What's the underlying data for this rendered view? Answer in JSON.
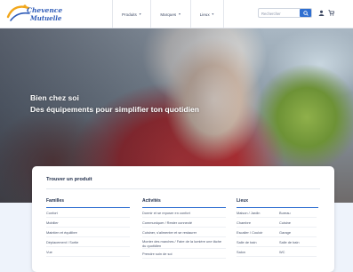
{
  "header": {
    "logo_line1": "Chevence",
    "logo_line2": "Mutuelle",
    "nav": [
      {
        "label": "Produits"
      },
      {
        "label": "Marques"
      },
      {
        "label": "Lieux"
      }
    ],
    "search": {
      "placeholder": "Rechercher"
    }
  },
  "hero": {
    "title": "Bien chez soi",
    "subtitle": "Des équipements pour simplifier ton quotidien"
  },
  "finder": {
    "title": "Trouver un produit",
    "columns": {
      "familles": {
        "heading": "Familles",
        "items": [
          "Confort",
          "Mobilier",
          "Maintien et équilibre",
          "Déplacement / Sortie",
          "Vue"
        ]
      },
      "activites": {
        "heading": "Activités",
        "items": [
          "Dormir et se reposer en confort",
          "Communiquer / Rester connecté",
          "Cuisiner, s'alimenter et se restaurer",
          "Monter des marches / Faire de la lumière une tâche du quotidien",
          "Prendre soin de soi"
        ]
      },
      "lieux": {
        "heading": "Lieux",
        "items": [
          "Maison / Jardin",
          "Bureau",
          "Chambre",
          "Cuisine",
          "Escalier / Couloir",
          "Garage",
          "Salle de bain",
          "Salle de bain",
          "Salon",
          "WC"
        ]
      }
    }
  }
}
